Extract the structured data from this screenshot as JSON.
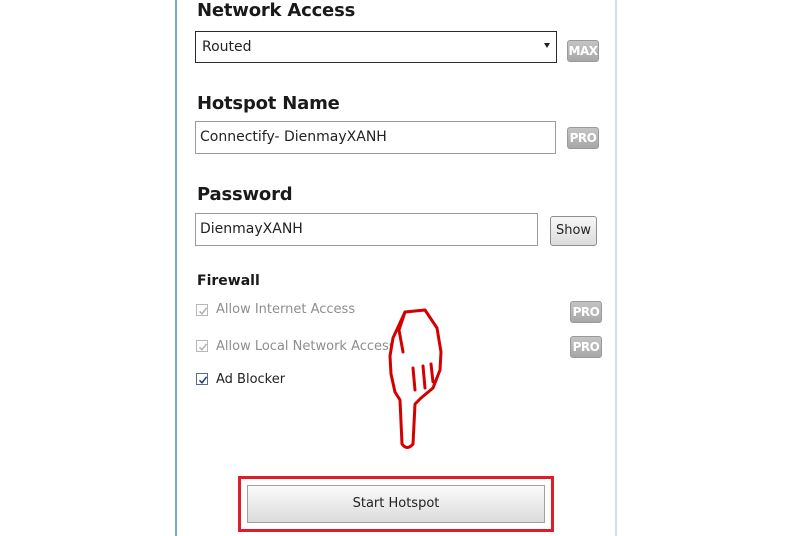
{
  "network_access": {
    "label": "Network Access",
    "selected": "Routed",
    "badge": "MAX"
  },
  "hotspot_name": {
    "label": "Hotspot Name",
    "value": "Connectify- DienmayXANH",
    "badge": "PRO"
  },
  "password": {
    "label": "Password",
    "value": "DienmayXANH",
    "show_label": "Show"
  },
  "firewall": {
    "label": "Firewall",
    "items": [
      {
        "label": "Allow Internet Access",
        "checked": true,
        "enabled": false,
        "badge": "PRO"
      },
      {
        "label": "Allow Local Network Access",
        "checked": true,
        "enabled": false,
        "badge": "PRO"
      },
      {
        "label": "Ad Blocker",
        "checked": true,
        "enabled": true
      }
    ]
  },
  "start_hotspot_label": "Start Hotspot",
  "annotation": {
    "icon": "pointing-hand-icon",
    "color": "#d40000",
    "highlight_color": "#e11c2a"
  }
}
